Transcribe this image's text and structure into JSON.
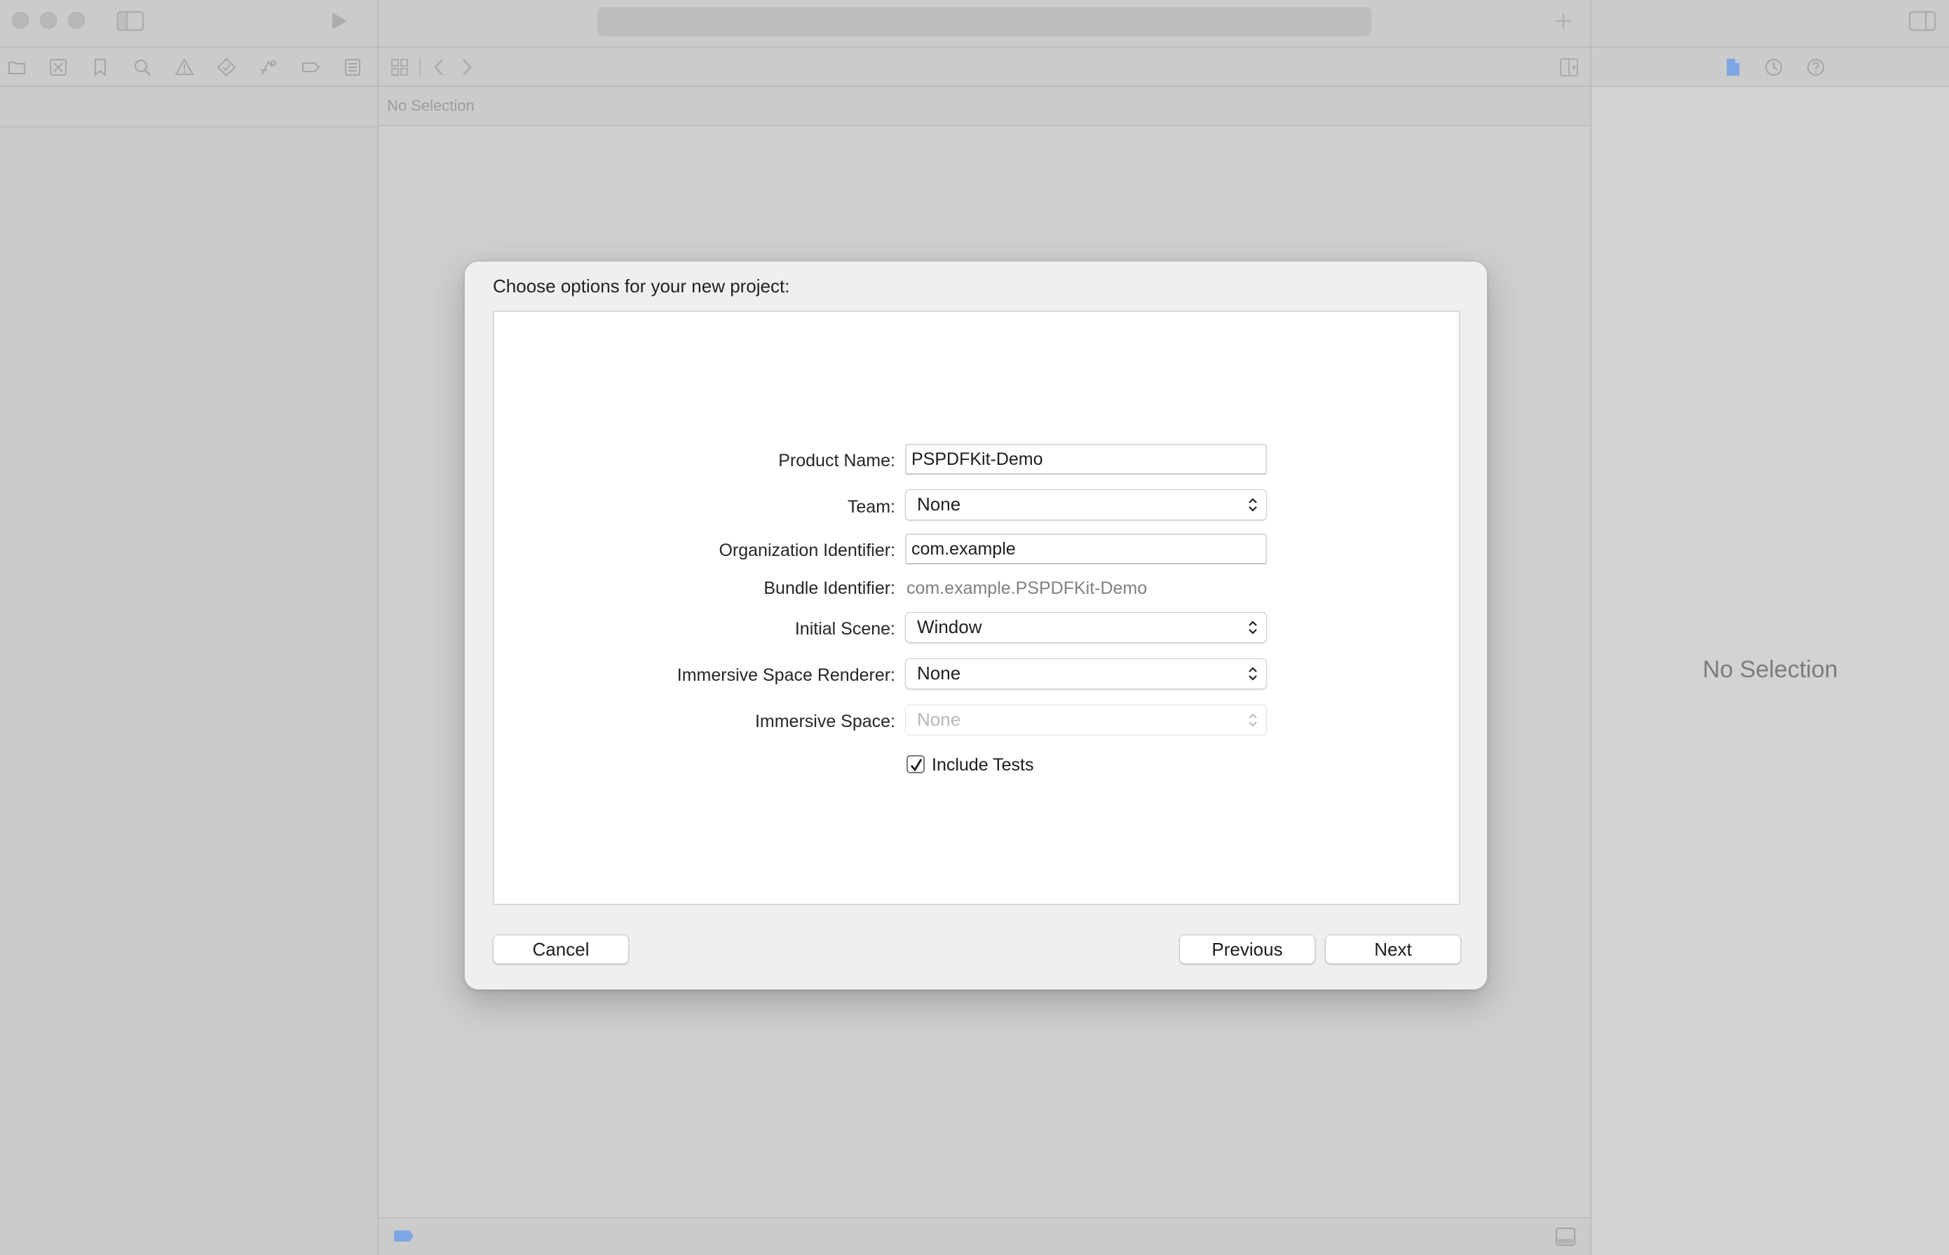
{
  "window": {
    "editor_jumpbar": "No Selection",
    "inspector_placeholder": "No Selection"
  },
  "dialog": {
    "title": "Choose options for your new project:",
    "fields": {
      "product_name": {
        "label": "Product Name:",
        "value": "PSPDFKit-Demo"
      },
      "team": {
        "label": "Team:",
        "value": "None"
      },
      "organization_identifier": {
        "label": "Organization Identifier:",
        "value": "com.example"
      },
      "bundle_identifier": {
        "label": "Bundle Identifier:",
        "value": "com.example.PSPDFKit-Demo"
      },
      "initial_scene": {
        "label": "Initial Scene:",
        "value": "Window"
      },
      "immersive_space_renderer": {
        "label": "Immersive Space Renderer:",
        "value": "None"
      },
      "immersive_space": {
        "label": "Immersive Space:",
        "value": "None",
        "enabled": false
      }
    },
    "include_tests": {
      "label": "Include Tests",
      "checked": true
    },
    "buttons": {
      "cancel": "Cancel",
      "previous": "Previous",
      "next": "Next"
    }
  },
  "icons": {
    "toolbar": [
      "sidebar-toggle-icon",
      "run-icon",
      "add-icon",
      "inspector-toggle-icon"
    ],
    "navigator_tabs": [
      "folder-icon",
      "source-control-icon",
      "bookmark-icon",
      "search-icon",
      "warning-icon",
      "test-icon",
      "debug-icon",
      "breakpoint-icon",
      "report-icon"
    ],
    "editor": [
      "grid-icon",
      "back-icon",
      "forward-icon",
      "add-editor-icon",
      "filter-icon",
      "debug-area-icon"
    ],
    "inspector_tabs": [
      "file-icon",
      "history-icon",
      "help-icon"
    ]
  },
  "colors": {
    "window_background": "#cfcfcf",
    "sheet_background": "#efefef",
    "accent": "#6f9be0"
  }
}
